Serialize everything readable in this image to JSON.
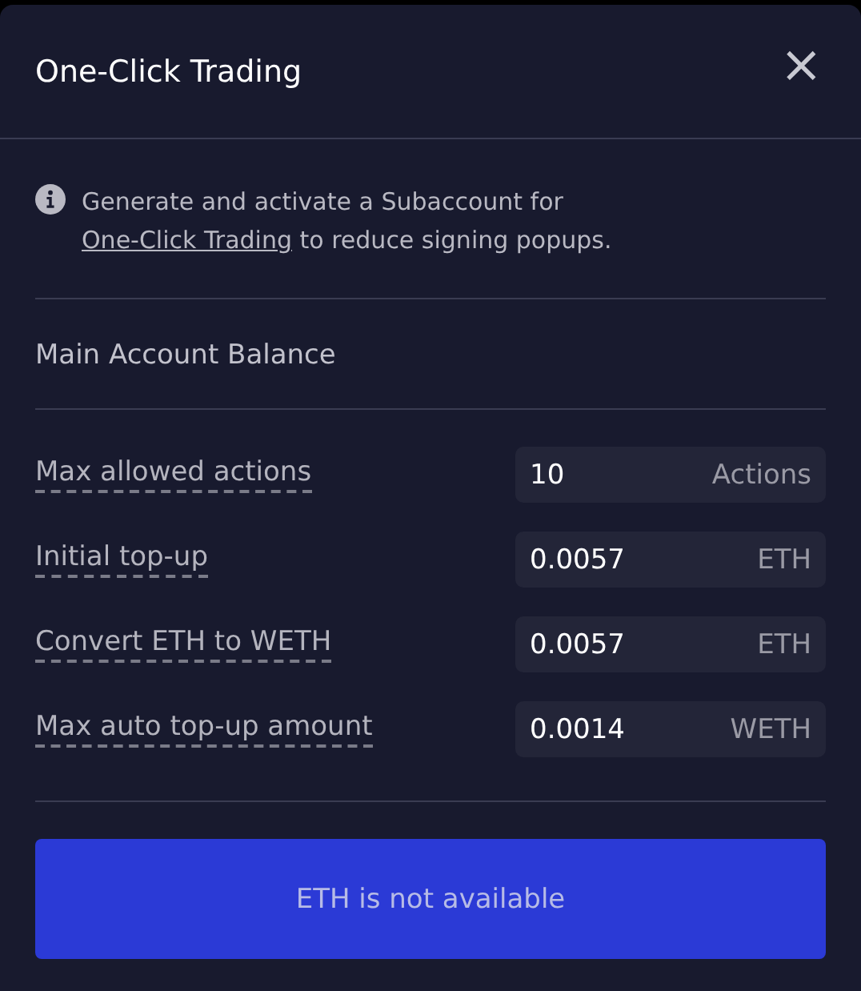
{
  "dialog": {
    "title": "One-Click Trading",
    "close": "×"
  },
  "info": {
    "before": "Generate and activate a Subaccount for",
    "link": "One-Click Trading",
    "after": "to reduce signing popups."
  },
  "section_title": "Main Account Balance",
  "fields": [
    {
      "label": "Max allowed actions",
      "value": "10",
      "unit": "Actions"
    },
    {
      "label": "Initial top-up",
      "value": "0.0057",
      "unit": "ETH"
    },
    {
      "label": "Convert ETH to WETH",
      "value": "0.0057",
      "unit": "ETH"
    },
    {
      "label": "Max auto top-up amount",
      "value": "0.0014",
      "unit": "WETH"
    }
  ],
  "submit": {
    "label": "ETH is not available",
    "disabled": true
  }
}
